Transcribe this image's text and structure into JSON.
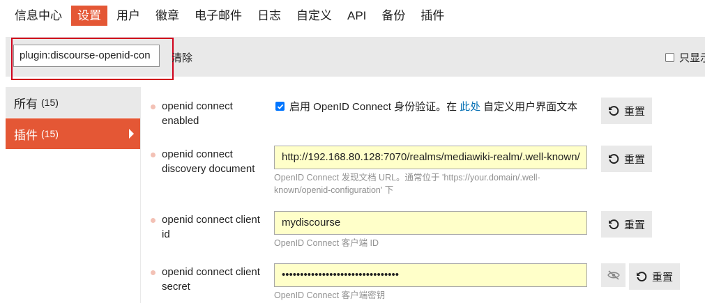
{
  "nav": {
    "tabs": [
      {
        "label": "信息中心"
      },
      {
        "label": "设置"
      },
      {
        "label": "用户"
      },
      {
        "label": "徽章"
      },
      {
        "label": "电子邮件"
      },
      {
        "label": "日志"
      },
      {
        "label": "自定义"
      },
      {
        "label": "API"
      },
      {
        "label": "备份"
      },
      {
        "label": "插件"
      }
    ],
    "active_index": 1
  },
  "filter": {
    "value": "plugin:discourse-openid-con",
    "clear_label": "清除",
    "only_show_label": "只显示"
  },
  "sidebar": {
    "items": [
      {
        "label": "所有",
        "count": "(15)"
      },
      {
        "label": "插件",
        "count": "(15)"
      }
    ]
  },
  "settings": [
    {
      "name": "openid connect enabled",
      "checkbox_checked": true,
      "checkbox_text_before": "启用 OpenID Connect 身份验证。在",
      "link_text": "此处",
      "checkbox_text_after": "自定义用户界面文本",
      "reset_label": "重置"
    },
    {
      "name": "openid connect discovery document",
      "value": "http://192.168.80.128:7070/realms/mediawiki-realm/.well-known/",
      "description": "OpenID Connect 发现文档 URL。通常位于 'https://your.domain/.well-known/openid-configuration' 下",
      "reset_label": "重置"
    },
    {
      "name": "openid connect client id",
      "value": "mydiscourse",
      "description": "OpenID Connect 客户端 ID",
      "reset_label": "重置"
    },
    {
      "name": "openid connect client secret",
      "value": "••••••••••••••••••••••••••••••••",
      "description": "OpenID Connect 客户端密钥",
      "reset_label": "重置"
    }
  ],
  "colors": {
    "accent": "#e45735",
    "highlight": "#ffffc9",
    "link": "#0a72b5",
    "annotation_box": "#d0021b"
  }
}
